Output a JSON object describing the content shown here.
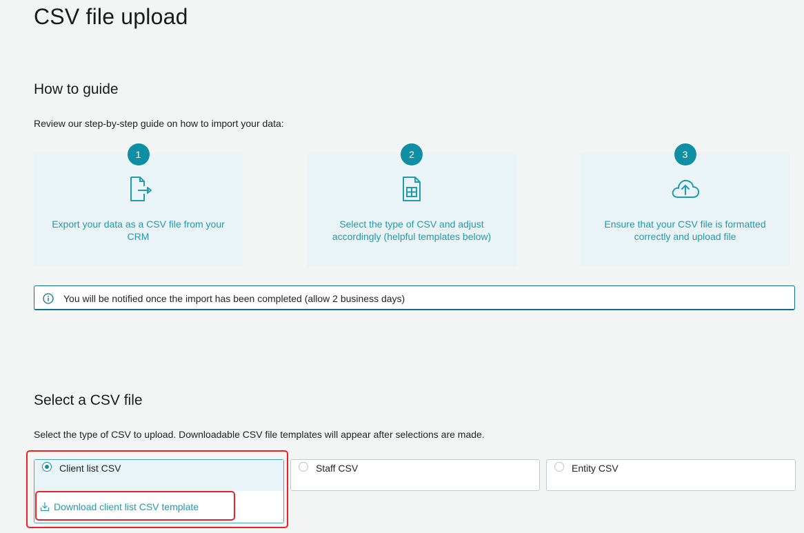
{
  "page": {
    "title": "CSV file upload"
  },
  "guide": {
    "title": "How to guide",
    "description": "Review our step-by-step guide on how to import your data:",
    "steps": [
      {
        "number": "1",
        "icon": "file-export-icon",
        "text": "Export your data as a CSV file from your CRM"
      },
      {
        "number": "2",
        "icon": "spreadsheet-icon",
        "text": "Select the type of CSV and adjust accordingly (helpful templates below)"
      },
      {
        "number": "3",
        "icon": "cloud-upload-icon",
        "text": "Ensure that your CSV file is formatted correctly and upload file"
      }
    ],
    "notice": {
      "icon": "info-icon",
      "text": "You will be notified once the import has been completed (allow 2 business days)"
    }
  },
  "select": {
    "title": "Select a CSV file",
    "description": "Select the type of CSV to upload. Downloadable CSV file templates will appear after selections are made.",
    "options": [
      {
        "label": "Client list CSV",
        "selected": true
      },
      {
        "label": "Staff CSV",
        "selected": false
      },
      {
        "label": "Entity CSV",
        "selected": false
      }
    ],
    "download": {
      "icon": "download-icon",
      "label": "Download client list CSV template"
    }
  },
  "colors": {
    "accent": "#0e8fa3",
    "link": "#1f9ab0",
    "card_bg": "#eaf3f5",
    "highlight": "#e8202a"
  }
}
